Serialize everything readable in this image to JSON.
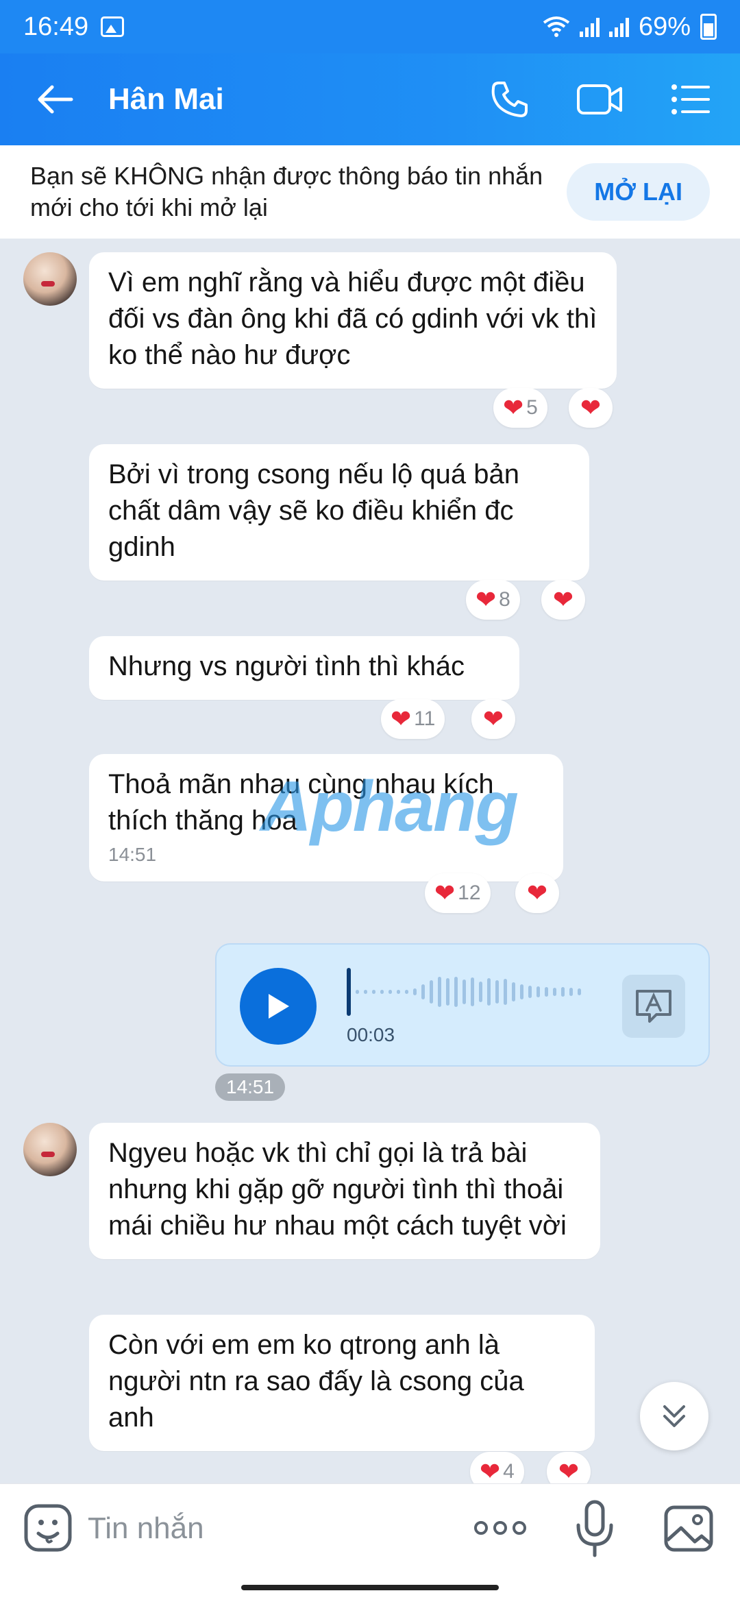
{
  "status_bar": {
    "time": "16:49",
    "battery": "69%"
  },
  "header": {
    "contact_name": "Hân Mai"
  },
  "notice": {
    "text": "Bạn sẽ KHÔNG nhận được thông báo tin nhắn mới cho tới khi mở lại",
    "reopen_label": "MỞ LẠI"
  },
  "messages": [
    {
      "text": "Vì em nghĩ rằng và hiểu được một điều đối vs đàn ông khi đã có gdinh với vk thì ko thể nào hư được",
      "reaction_count": "5"
    },
    {
      "text": "Bởi vì trong csong nếu lộ quá bản chất dâm vậy sẽ ko điều khiển đc gdinh",
      "reaction_count": "8"
    },
    {
      "text": "Nhưng vs người tình thì khác",
      "reaction_count": "11"
    },
    {
      "text": "Thoả mãn nhau cùng nhau kích thích thăng hoa",
      "time": "14:51",
      "reaction_count": "12"
    },
    {
      "text": "Ngyeu hoặc vk thì chỉ gọi là trả bài nhưng khi gặp gỡ người tình thì thoải mái chiều hư nhau một cách tuyệt vời"
    },
    {
      "text": "Còn với em em ko qtrong anh là người ntn ra sao đấy là csong của anh",
      "reaction_count": "4"
    }
  ],
  "voice_message": {
    "duration": "00:03",
    "time": "14:51"
  },
  "watermark": {
    "part1": "Aphang",
    "part2": ""
  },
  "input": {
    "placeholder": "Tin nhắn"
  },
  "colors": {
    "header": "#1e88f3",
    "accent": "#0a6fdc",
    "heart": "#e8283a",
    "background": "#e2e8f0"
  }
}
